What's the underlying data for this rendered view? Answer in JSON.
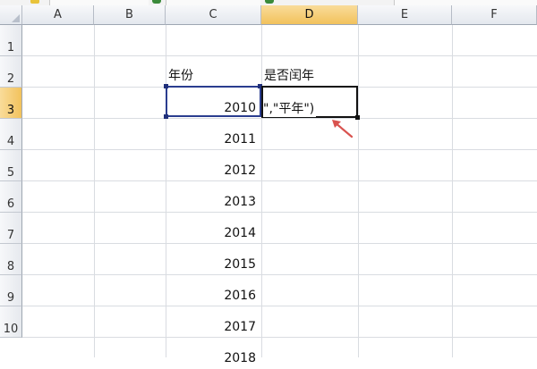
{
  "columns": [
    "A",
    "B",
    "C",
    "D",
    "E",
    "F"
  ],
  "active_column": "D",
  "rows": [
    "1",
    "2",
    "3",
    "4",
    "5",
    "6",
    "7",
    "8",
    "9",
    "10"
  ],
  "active_row": "3",
  "headers": {
    "year": "年份",
    "is_leap": "是否闰年"
  },
  "years": [
    "2010",
    "2011",
    "2012",
    "2013",
    "2014",
    "2015",
    "2016",
    "2017",
    "2018"
  ],
  "editing": {
    "cell": "D3",
    "visible_text": "\",\"平年\")"
  },
  "colors": {
    "selection_border": "#2a3d8f",
    "active_header": "#f2c25c",
    "arrow": "#d9534f",
    "excel_icon": "#3a8a3a"
  },
  "icons": [
    "excel-icon",
    "annotation-arrow-icon"
  ]
}
